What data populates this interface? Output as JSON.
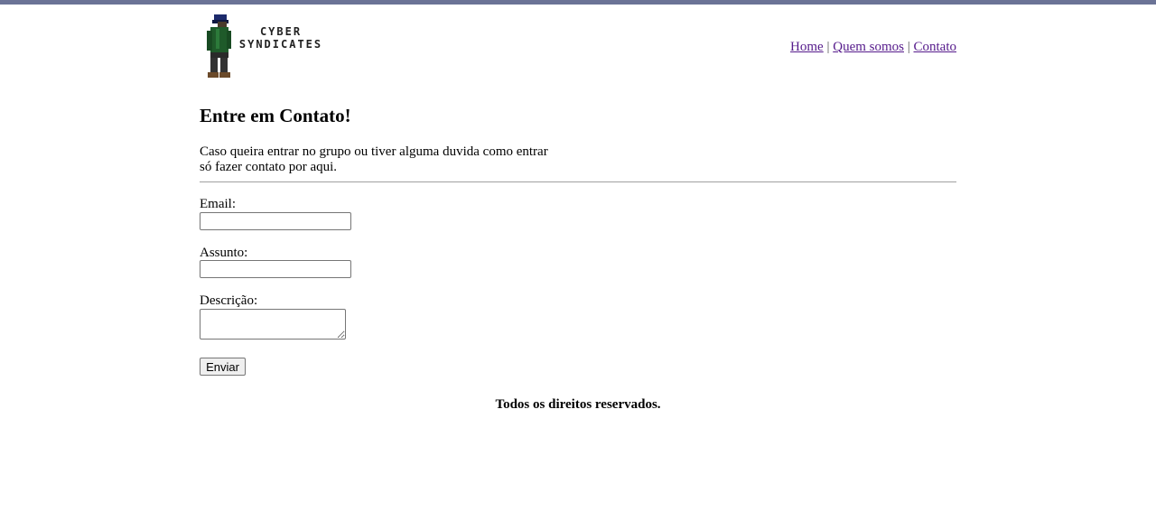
{
  "header": {
    "logo_line1": "CYBER",
    "logo_line2": "SYNDICATES",
    "nav": {
      "home": "Home",
      "about": "Quem somos",
      "contact": "Contato",
      "separator": "|"
    }
  },
  "main": {
    "title": "Entre em Contato!",
    "intro_line1": "Caso queira entrar no grupo ou tiver alguma duvida como entrar",
    "intro_line2": "só fazer contato por aqui.",
    "form": {
      "email_label": "Email:",
      "email_value": "",
      "subject_label": "Assunto:",
      "subject_value": "",
      "description_label": "Descrição:",
      "description_value": "",
      "submit_label": "Enviar"
    }
  },
  "footer": {
    "text": "Todos os direitos reservados."
  },
  "colors": {
    "topbar": "#6b7396",
    "link_visited": "#551a8b",
    "character_jacket": "#1f5a2a",
    "character_cap": "#1c2a6b"
  }
}
